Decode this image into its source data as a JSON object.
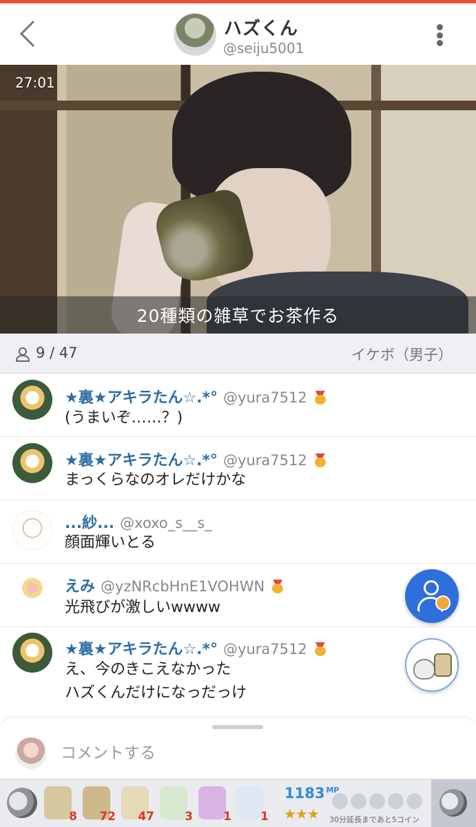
{
  "header": {
    "name": "ハズくん",
    "handle": "@seiju5001"
  },
  "video": {
    "timer": "27:01",
    "caption": "20種類の雑草でお茶作る"
  },
  "info": {
    "viewers": "9 / 47",
    "category": "イケボ（男子）"
  },
  "comments": [
    {
      "name": "★裏★アキラたん☆.*°",
      "handle": "@yura7512",
      "lines": [
        "(うまいぞ……？)"
      ],
      "medal": true
    },
    {
      "name": "★裏★アキラたん☆.*°",
      "handle": "@yura7512",
      "lines": [
        "まっくらなのオレだけかな"
      ],
      "medal": true
    },
    {
      "name": "...紗...",
      "handle": "@xoxo_s__s_",
      "lines": [
        "顔面輝いとる"
      ],
      "medal": false
    },
    {
      "name": "えみ",
      "handle": "@yzNRcbHnE1VOHWN",
      "lines": [
        "光飛びが激しいwwww"
      ],
      "medal": true
    },
    {
      "name": "★裏★アキラたん☆.*°",
      "handle": "@yura7512",
      "lines": [
        "え、今のきこえなかった",
        "ハズくんだけになっだっけ"
      ],
      "medal": true
    }
  ],
  "input": {
    "placeholder": "コメントする"
  },
  "gifts": [
    {
      "icon": "tea-cup-10-icon",
      "count": "8",
      "color": "#d7c79e"
    },
    {
      "icon": "tea-can-icon",
      "count": "72",
      "color": "#cdb98a"
    },
    {
      "icon": "tea-party-icon",
      "count": "47",
      "color": "#e6d8b8"
    },
    {
      "icon": "frog-headphones-icon",
      "count": "3",
      "color": "#d7e9cf"
    },
    {
      "icon": "purple-bear-icon",
      "count": "1",
      "color": "#d9b3e3"
    },
    {
      "icon": "ghost-penguin-icon",
      "count": "1",
      "color": "#dfe7f2"
    }
  ],
  "mp": {
    "value": "1183",
    "unit": "MP",
    "stars": "★★★",
    "extend_text": "30分延長まであと5コイン"
  },
  "colors": {
    "accent": "#e8523a",
    "name_blue": "#2a6ea6",
    "follow_blue": "#2f6fdb"
  }
}
